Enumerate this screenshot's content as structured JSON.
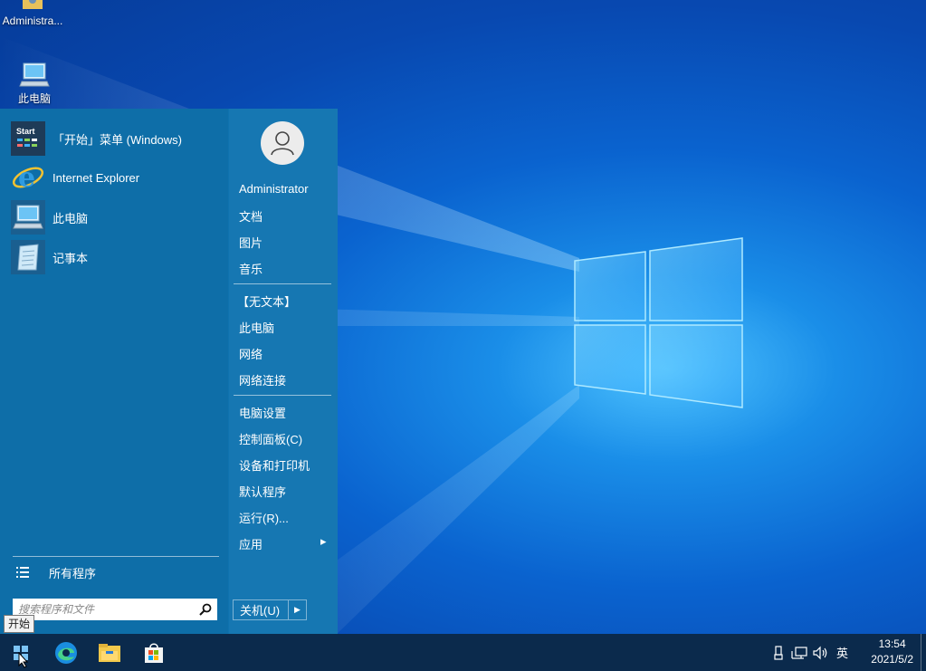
{
  "desktop": {
    "icons": [
      {
        "label": "Administra..."
      },
      {
        "label": "此电脑"
      }
    ]
  },
  "start_menu": {
    "pinned": [
      {
        "label": "「开始」菜单 (Windows)",
        "icon": "start-menu-app-icon"
      },
      {
        "label": "Internet Explorer",
        "icon": "internet-explorer-icon"
      },
      {
        "label": "此电脑",
        "icon": "computer-icon"
      },
      {
        "label": "记事本",
        "icon": "notepad-icon"
      }
    ],
    "all_programs": "所有程序",
    "search_placeholder": "搜索程序和文件",
    "user_name": "Administrator",
    "right_items": [
      "文档",
      "图片",
      "音乐",
      "【无文本】",
      "此电脑",
      "网络",
      "网络连接",
      "电脑设置",
      "控制面板(C)",
      "设备和打印机",
      "默认程序",
      "运行(R)...",
      "应用"
    ],
    "shutdown_label": "关机(U)",
    "shutdown_arrow": "▶",
    "submenu_arrow": "▸"
  },
  "tooltip": "开始",
  "taskbar": {
    "apps": [
      "start-button",
      "edge-icon",
      "file-explorer-icon",
      "microsoft-store-icon"
    ],
    "tray": {
      "input_language": "英",
      "time": "13:54",
      "date": "2021/5/2"
    }
  },
  "colors": {
    "start_menu_bg": "#0e6ea8",
    "taskbar_bg": "#0b2a4c",
    "accent": "#0078d7"
  }
}
